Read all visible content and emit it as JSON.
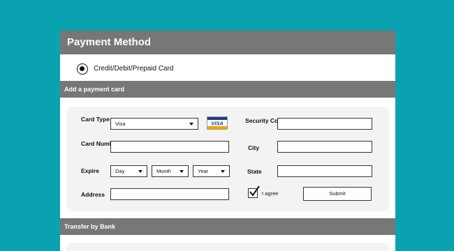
{
  "header": {
    "title": "Payment Method"
  },
  "payment_option": {
    "label": "Credit/Debit/Prepaid Card",
    "selected": true
  },
  "card_section": {
    "title": "Add a payment card",
    "card_type_label": "Card Type",
    "card_type_value": "Visa",
    "card_logo_text": "VISA",
    "card_number_label": "Card Number",
    "card_number_value": "",
    "expire_label": "Expire",
    "expire_day": "Day",
    "expire_month": "Month",
    "expire_year": "Year",
    "address_label": "Address",
    "address_value": "",
    "security_code_label": "Security Code",
    "security_code_value": "",
    "city_label": "City",
    "city_value": "",
    "state_label": "State",
    "state_value": "",
    "agree_label": "I agree",
    "agree_checked": true,
    "submit_label": "Submit"
  },
  "bank_section": {
    "title": "Transfer by Bank"
  },
  "colors": {
    "background": "#0aa1b1",
    "header_bar": "#777777",
    "card_box": "#f3f3f3",
    "visa_blue": "#1a3c8f",
    "visa_gold": "#f0a500"
  }
}
